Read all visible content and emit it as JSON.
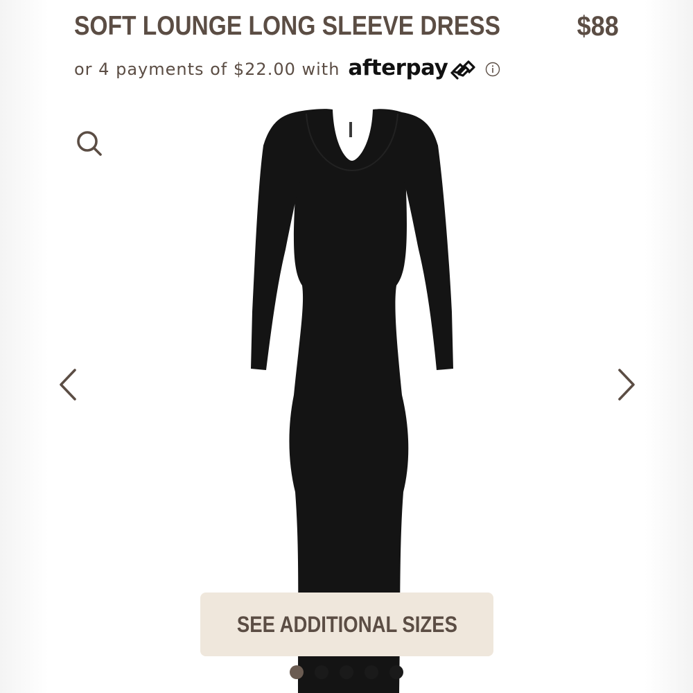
{
  "product": {
    "title": "SOFT LOUNGE LONG SLEEVE DRESS",
    "price": "$88"
  },
  "afterpay": {
    "installment_text": "or 4 payments of $22.00 with",
    "brand": "afterpay",
    "brand_icon": "afterpay-arrows-icon",
    "info_icon": "info-icon"
  },
  "gallery": {
    "zoom_icon": "search-icon",
    "prev_icon": "chevron-left-icon",
    "next_icon": "chevron-right-icon",
    "image_subject": "black long sleeve maxi dress",
    "dot_count": 5,
    "active_dot": 0
  },
  "cta": {
    "sizes_label": "SEE ADDITIONAL SIZES"
  },
  "colors": {
    "text_brown": "#5b4d44",
    "button_bg": "#efe7dc",
    "dress_black": "#141414"
  }
}
